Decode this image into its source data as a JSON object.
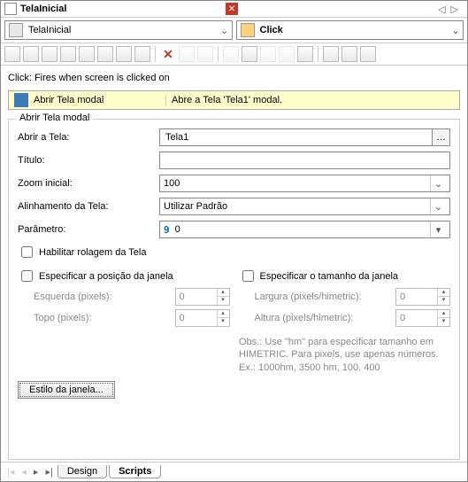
{
  "titlebar": {
    "title": "TelaInicial"
  },
  "selectors": {
    "left": "TelaInicial",
    "right": "Click"
  },
  "description": "Click: Fires when screen is clicked on",
  "action": {
    "name": "Abrir Tela modal",
    "desc": "Abre a Tela 'Tela1' modal."
  },
  "group": {
    "title": "Abrir Tela modal",
    "fields": {
      "abrir_label": "Abrir a Tela:",
      "abrir_value": "Tela1",
      "titulo_label": "Título:",
      "titulo_value": "",
      "zoom_label": "Zoom inicial:",
      "zoom_value": "100",
      "align_label": "Alinhamento da Tela:",
      "align_value": "Utilizar Padrão",
      "param_label": "Parâmetro:",
      "param_value": "0",
      "scroll_label": "Habilitar rolagem da Tela",
      "pos_label": "Especificar a posição da janela",
      "size_label": "Especificar o tamanho da janela",
      "esq_label": "Esquerda (pixels):",
      "esq_value": "0",
      "topo_label": "Topo (pixels):",
      "topo_value": "0",
      "larg_label": "Largura (pixels/himetric):",
      "larg_value": "0",
      "alt_label": "Altura (pixels/himetric):",
      "alt_value": "0",
      "obs": "Obs.: Use \"hm\" para especificar tamanho em HIMETRIC. Para pixels, use apenas números. Ex.: 1000hm, 3500 hm, 100, 400",
      "style_btn": "Estilo da janela..."
    }
  },
  "tabs": {
    "design": "Design",
    "scripts": "Scripts"
  }
}
